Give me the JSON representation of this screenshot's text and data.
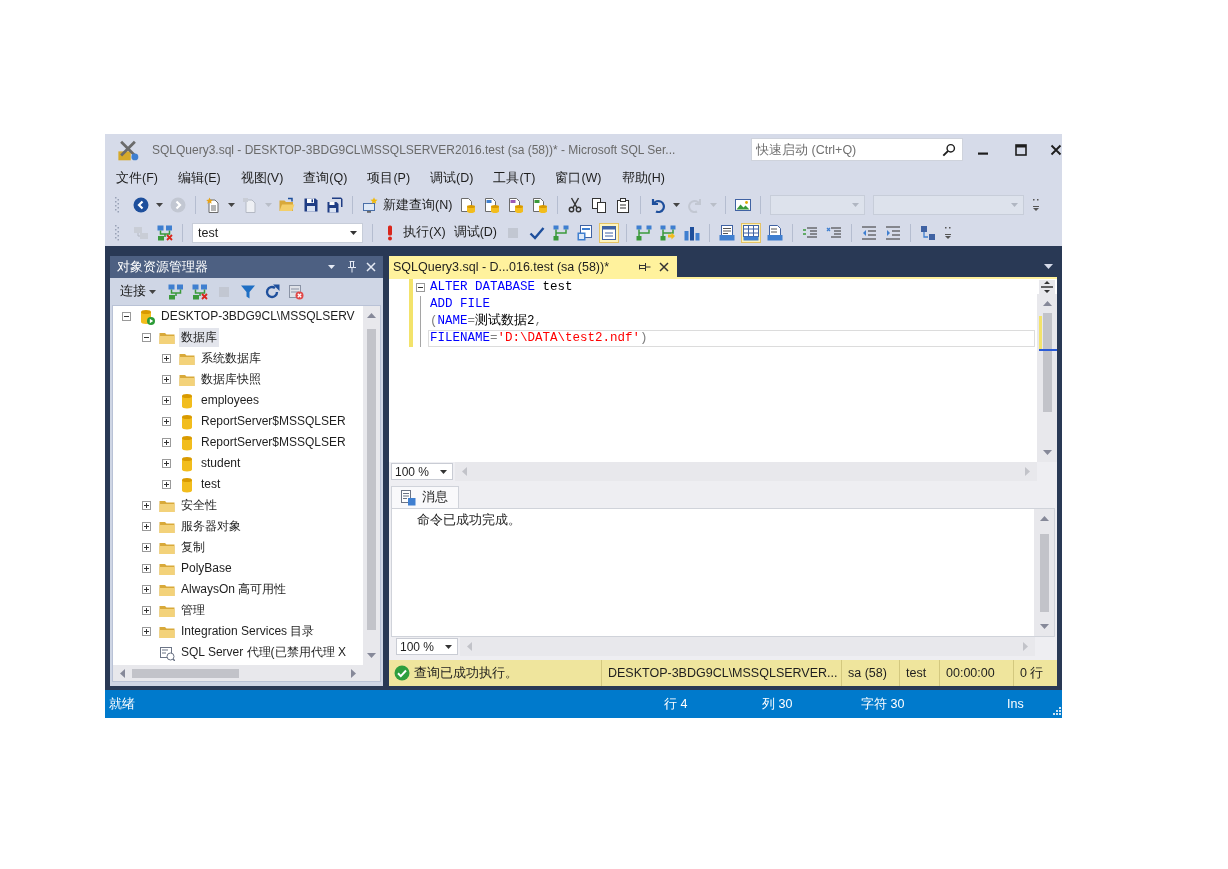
{
  "window": {
    "title": "SQLQuery3.sql - DESKTOP-3BDG9CL\\MSSQLSERVER2016.test (sa (58))* - Microsoft SQL Ser...",
    "quick_launch": {
      "placeholder": "快速启动 (Ctrl+Q)"
    }
  },
  "menu": [
    "文件(F)",
    "编辑(E)",
    "视图(V)",
    "查询(Q)",
    "项目(P)",
    "调试(D)",
    "工具(T)",
    "窗口(W)",
    "帮助(H)"
  ],
  "toolbar_1": {
    "new_query": "新建查询(N)"
  },
  "toolbar_2": {
    "database": "test",
    "execute": "执行(X)",
    "debug": "调试(D)",
    "toggle": {
      "on": true
    },
    "result_modes": [
      {
        "selected": false
      },
      {
        "selected": true
      },
      {
        "selected": false
      }
    ]
  },
  "object_explorer": {
    "title": "对象资源管理器",
    "connect": "连接",
    "tree": [
      {
        "kind": "server",
        "label": "DESKTOP-3BDG9CL\\MSSQLSERV",
        "expanded": true,
        "selected": false,
        "children": [
          {
            "kind": "folder",
            "label": "数据库",
            "expanded": true,
            "selected": true,
            "children": [
              {
                "kind": "folder",
                "label": "系统数据库",
                "expanded": false,
                "selected": false
              },
              {
                "kind": "folder",
                "label": "数据库快照",
                "expanded": false,
                "selected": false
              },
              {
                "kind": "database",
                "label": "employees",
                "expanded": false,
                "selected": false
              },
              {
                "kind": "database",
                "label": "ReportServer$MSSQLSER",
                "expanded": false,
                "selected": false
              },
              {
                "kind": "database",
                "label": "ReportServer$MSSQLSER",
                "expanded": false,
                "selected": false
              },
              {
                "kind": "database",
                "label": "student",
                "expanded": false,
                "selected": false
              },
              {
                "kind": "database",
                "label": "test",
                "expanded": false,
                "selected": false
              }
            ]
          },
          {
            "kind": "folder",
            "label": "安全性",
            "expanded": false,
            "selected": false
          },
          {
            "kind": "folder",
            "label": "服务器对象",
            "expanded": false,
            "selected": false
          },
          {
            "kind": "folder",
            "label": "复制",
            "expanded": false,
            "selected": false
          },
          {
            "kind": "folder",
            "label": "PolyBase",
            "expanded": false,
            "selected": false
          },
          {
            "kind": "folder",
            "label": "AlwaysOn 高可用性",
            "expanded": false,
            "selected": false
          },
          {
            "kind": "folder",
            "label": "管理",
            "expanded": false,
            "selected": false
          },
          {
            "kind": "folder",
            "label": "Integration Services 目录",
            "expanded": false,
            "selected": false
          },
          {
            "kind": "agent",
            "label": "SQL Server 代理(已禁用代理 X",
            "selected": false
          }
        ]
      }
    ]
  },
  "editor": {
    "tab": {
      "title": "SQLQuery3.sql - D...016.test (sa (58))*",
      "selected": true
    },
    "lines": [
      {
        "fold": true,
        "changed": true,
        "current": false,
        "tokens": [
          {
            "kind": "keyword",
            "text": "ALTER DATABASE"
          },
          {
            "kind": "plain",
            "text": " test"
          }
        ]
      },
      {
        "fold": false,
        "changed": true,
        "current": false,
        "tokens": [
          {
            "kind": "keyword",
            "text": "ADD FILE"
          }
        ]
      },
      {
        "fold": false,
        "changed": true,
        "current": false,
        "tokens": [
          {
            "kind": "operator",
            "text": "("
          },
          {
            "kind": "keyword",
            "text": "NAME"
          },
          {
            "kind": "operator",
            "text": "="
          },
          {
            "kind": "plain",
            "text": "测试数据2"
          },
          {
            "kind": "operator",
            "text": ","
          }
        ]
      },
      {
        "fold": false,
        "changed": true,
        "current": true,
        "tokens": [
          {
            "kind": "keyword",
            "text": "FILENAME"
          },
          {
            "kind": "operator",
            "text": "="
          },
          {
            "kind": "string",
            "text": "'D:\\DATA\\test2.ndf'"
          },
          {
            "kind": "operator",
            "text": ")"
          }
        ]
      }
    ],
    "zoom": "100 %"
  },
  "messages": {
    "tab": {
      "label": "消息",
      "selected": true
    },
    "text": "命令已成功完成。",
    "zoom": "100 %"
  },
  "query_status": {
    "message": "查询已成功执行。",
    "server": "DESKTOP-3BDG9CL\\MSSQLSERVER...",
    "login": "sa (58)",
    "database": "test",
    "elapsed": "00:00:00",
    "rows": "0 行"
  },
  "status_bar": {
    "state": "就绪",
    "line": "行 4",
    "column": "列 30",
    "char": "字符 30",
    "mode": "Ins"
  }
}
